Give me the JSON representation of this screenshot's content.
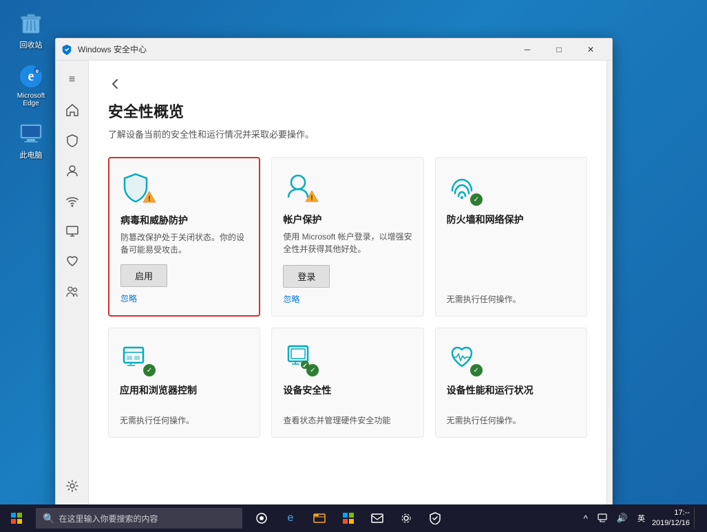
{
  "desktop": {
    "icons": [
      {
        "id": "recycle-bin",
        "label": "回收站",
        "symbol": "🗑"
      },
      {
        "id": "edge",
        "label": "Microsoft Edge",
        "symbol": "🌐"
      },
      {
        "id": "computer",
        "label": "此电脑",
        "symbol": "💻"
      }
    ]
  },
  "taskbar": {
    "search_placeholder": "在这里输入你要搜索的内容",
    "tray": {
      "time": "17:--",
      "date": "2019/12/16"
    }
  },
  "window": {
    "title": "Windows 安全中心",
    "controls": {
      "minimize": "─",
      "maximize": "□",
      "close": "✕"
    }
  },
  "page": {
    "title": "安全性概览",
    "subtitle": "了解设备当前的安全性和运行情况并采取必要操作。"
  },
  "cards": [
    {
      "id": "virus-protection",
      "title": "病毒和威胁防护",
      "desc": "防篡改保护处于关闭状态。你的设备可能易受攻击。",
      "action_label": "启用",
      "ignore_label": "忽略",
      "status": "warning",
      "highlighted": true
    },
    {
      "id": "account-protection",
      "title": "帐户保护",
      "desc": "使用 Microsoft 帐户登录，以增强安全性并获得其他好处。",
      "action_label": "登录",
      "ignore_label": "忽略",
      "status": "warning",
      "highlighted": false
    },
    {
      "id": "firewall",
      "title": "防火墙和网络保护",
      "desc": "无需执行任何操作。",
      "status": "ok",
      "highlighted": false
    },
    {
      "id": "app-browser",
      "title": "应用和浏览器控制",
      "desc": "无需执行任何操作。",
      "status": "ok",
      "highlighted": false
    },
    {
      "id": "device-security",
      "title": "设备安全性",
      "desc": "查看状态并管理硬件安全功能",
      "status": "ok",
      "highlighted": false
    },
    {
      "id": "device-performance",
      "title": "设备性能和运行状况",
      "desc": "无需执行任何操作。",
      "status": "ok",
      "highlighted": false
    }
  ],
  "sidebar": {
    "settings_label": "设置"
  }
}
